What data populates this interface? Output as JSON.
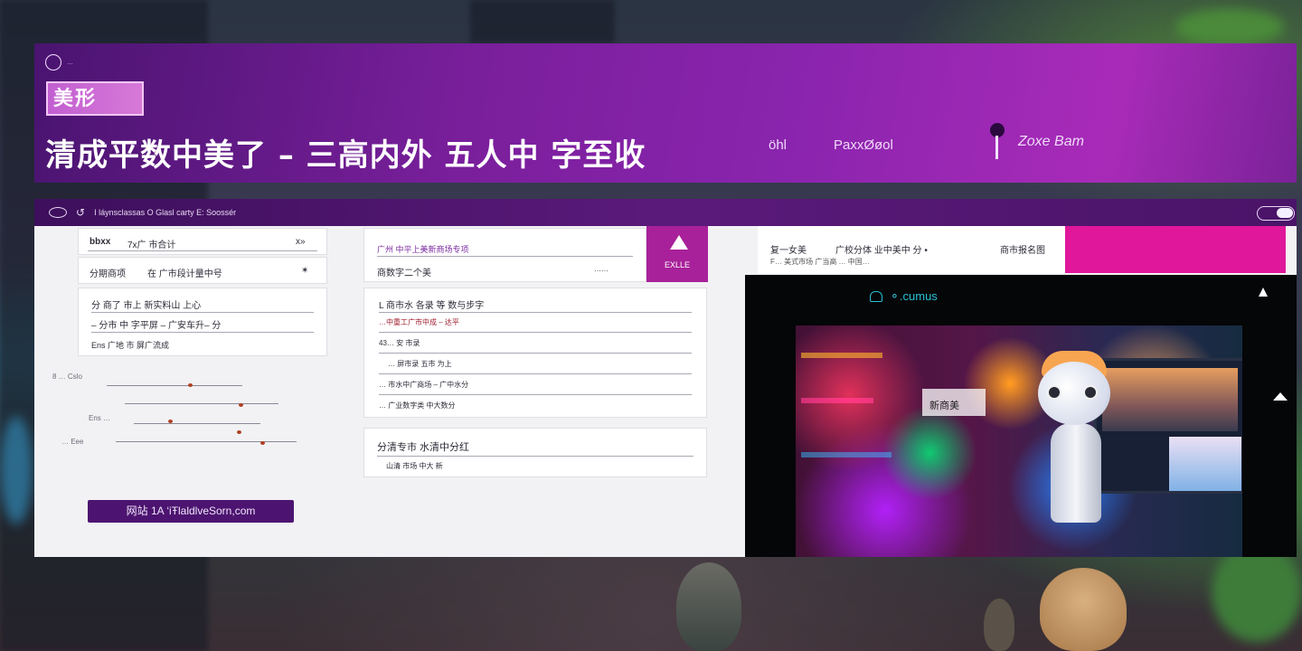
{
  "banner": {
    "small_logo_text": "…",
    "logo_text": "美形",
    "title": "清成平数中美了 – 三高内外 五人中 字至收",
    "nav": [
      "öhl",
      "PaxxØøol"
    ],
    "user_name": "Zoxe Bam"
  },
  "window": {
    "topbar_text": "I láynsclassas O Glasl carty E: Soossér"
  },
  "left": {
    "card1": {
      "label": "bbxx",
      "value": "7x广 市合计",
      "end": "x»"
    },
    "card2": {
      "label": "分期商项",
      "value": "在 广市段计量中号",
      "end": "✶"
    },
    "card3": {
      "rows": [
        "分 商了 市上 新实料山 上心",
        "– 分市 中 字平屏 – 广安车升– 分",
        "Ens 广地 市 屏广流成"
      ]
    },
    "scribble_labels": [
      "8 … Cslo",
      "Ens …",
      "… Eee"
    ],
    "cta_label": "网站 1A ‘iŦlaldlveSorn,com"
  },
  "middle": {
    "card1": {
      "row1": "广州 中平上美新商场专项",
      "row2": "商数字二个美",
      "row2_end": "……"
    },
    "tag_label": "EXLLE",
    "card2": {
      "title": "L 商市水 各录 等 数与步字",
      "rows": [
        "…中重工广市中成 – 达平",
        "43… 安 市录",
        "… 屏市录 五市 为上",
        "… 市水中广商场 – 广中水分",
        "… 广业数字类 中大数分"
      ]
    },
    "card3": {
      "title": "分清专市 水清中分红",
      "row": "山清 市场 中大 新"
    }
  },
  "right": {
    "bar_labels": [
      "复一女美",
      "广校分体 业中美中 分 •",
      "商市报名图"
    ],
    "bar_sub": "F… 美式市场 广当高 … 中国…",
    "media_head": "⚬.cumus",
    "scene_label": "新商美"
  }
}
